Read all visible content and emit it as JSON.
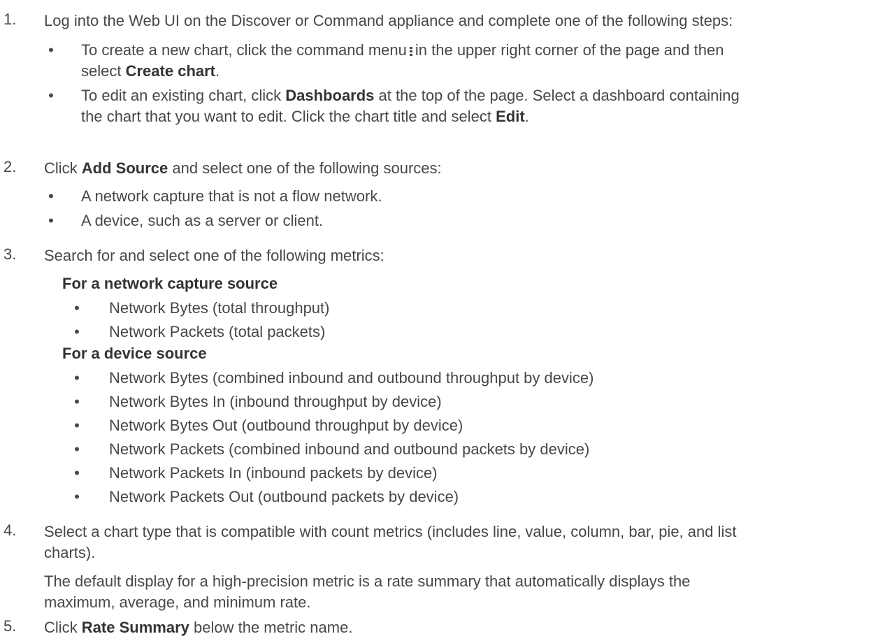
{
  "steps": [
    {
      "number": "1.",
      "text": "Log into the Web UI on the Discover or Command appliance and complete one of the following steps:",
      "bullets": [
        {
          "pre": "To create a new chart, click the command menu",
          "icon": "vertical-ellipsis-icon",
          "mid": "in the upper right corner of the page and then",
          "line2_pre": "select",
          "bold": "Create chart",
          "post": "."
        },
        {
          "line1": "To edit an existing chart, click",
          "bold1": "Dashboards",
          "line1_post": "at the top of the page. Select a dashboard containing",
          "line2_pre": "the chart that you want to edit. Click the chart title and select",
          "bold2": "Edit",
          "post": "."
        }
      ]
    },
    {
      "number": "2.",
      "pre": "Click",
      "bold": "Add Source",
      "post": "and select one of the following sources:",
      "bullets": [
        "A network capture that is not a flow network.",
        "A device, such as a server or client."
      ]
    },
    {
      "number": "3.",
      "text": "Search for and select one of the following metrics:",
      "groups": [
        {
          "heading": "For a network capture source",
          "items": [
            "Network Bytes (total throughput)",
            "Network Packets (total packets)"
          ]
        },
        {
          "heading": "For a device source",
          "items": [
            "Network Bytes (combined inbound and outbound throughput by device)",
            "Network Bytes In (inbound throughput by device)",
            "Network Bytes Out (outbound throughput by device)",
            "Network Packets (combined inbound and outbound packets by device)",
            "Network Packets In (inbound packets by device)",
            "Network Packets Out (outbound packets by device)"
          ]
        }
      ]
    },
    {
      "number": "4.",
      "text_line1": "Select a chart type that is compatible with count metrics (includes line, value, column, bar, pie, and list",
      "text_line2": "charts).",
      "note_line1": "The default display for a high-precision metric is a rate summary that automatically displays the",
      "note_line2": "maximum, average, and minimum rate."
    },
    {
      "number": "5.",
      "pre": "Click",
      "bold": "Rate Summary",
      "post": "below the metric name."
    }
  ],
  "bullet_glyph": "•"
}
